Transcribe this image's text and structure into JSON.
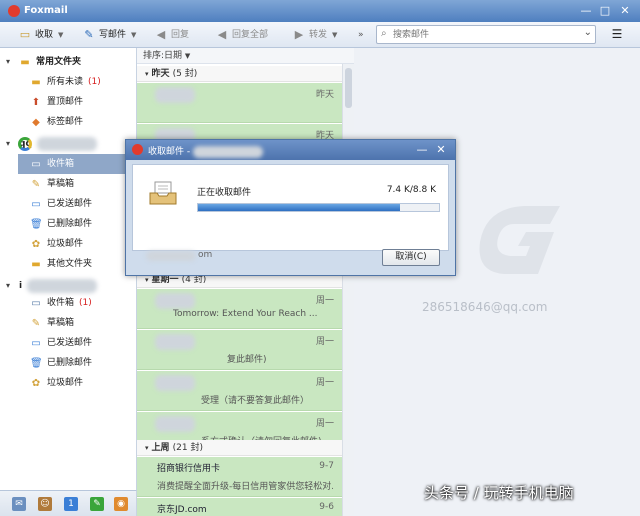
{
  "window": {
    "title": "Foxmail"
  },
  "toolbar": {
    "receive_label": "收取",
    "compose_label": "写邮件",
    "reply_label": "回复",
    "reply_all_label": "回复全部",
    "forward_label": "转发",
    "search_placeholder": "搜索邮件"
  },
  "sidebar": {
    "common_group": "常用文件夹",
    "common": [
      {
        "label": "所有未读",
        "count": "(1)"
      },
      {
        "label": "置顶邮件",
        "count": ""
      },
      {
        "label": "标签邮件",
        "count": ""
      }
    ],
    "account1_prefix": "qq",
    "account1": [
      {
        "label": "收件箱",
        "count": ""
      },
      {
        "label": "草稿箱",
        "count": ""
      },
      {
        "label": "已发送邮件",
        "count": ""
      },
      {
        "label": "已删除邮件",
        "count": ""
      },
      {
        "label": "垃圾邮件",
        "count": ""
      },
      {
        "label": "其他文件夹",
        "count": ""
      }
    ],
    "account2_prefix": "i",
    "account2": [
      {
        "label": "收件箱",
        "count": "(1)"
      },
      {
        "label": "草稿箱",
        "count": ""
      },
      {
        "label": "已发送邮件",
        "count": ""
      },
      {
        "label": "已删除邮件",
        "count": ""
      },
      {
        "label": "垃圾邮件",
        "count": ""
      }
    ]
  },
  "maillist": {
    "sort_label": "排序:日期",
    "groups": [
      {
        "title": "昨天",
        "count": "(5 封)"
      },
      {
        "title": "星期一",
        "count": "(4 封)"
      },
      {
        "title": "上周",
        "count": "(21 封)"
      }
    ],
    "yesterday_mails": [
      {
        "sender": "",
        "date": "昨天",
        "subject": ""
      },
      {
        "sender": "",
        "date": "昨天",
        "subject": ""
      }
    ],
    "hidden_mail_suffix": "om",
    "monday_mails": [
      {
        "sender": "",
        "date": "周一",
        "subject": "Tomorrow: Extend Your Reach ..."
      },
      {
        "sender": "",
        "date": "周一",
        "subject": "复此邮件)"
      },
      {
        "sender": "",
        "date": "周一",
        "subject": "受理（请不要答复此邮件）"
      },
      {
        "sender": "",
        "date": "周一",
        "subject": "系方式确认（请勿回复此邮件)"
      }
    ],
    "lastweek_mails": [
      {
        "sender": "招商银行信用卡",
        "date": "9-7",
        "subject": "消费提醒全面升级-每日信用管家供您轻松对..."
      },
      {
        "sender": "京东JD.com",
        "date": "9-6",
        "subject": ""
      }
    ]
  },
  "preview": {
    "account": "286518646@qq.com"
  },
  "dialog": {
    "title": "收取邮件 -",
    "status": "正在收取邮件",
    "size": "7.4 K/8.8 K",
    "progress_fraction": 0.84,
    "cancel_label": "取消(C)"
  },
  "watermark": "头条号 / 玩转手机电脑",
  "colors": {
    "accent": "#4f7fbf",
    "unread_count": "#d62020",
    "mail_highlight": "#c9e7c1",
    "progress": "#2e6fc2"
  }
}
